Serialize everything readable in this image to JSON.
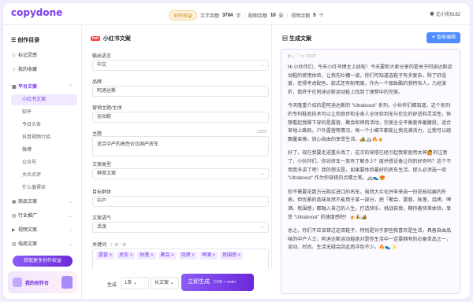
{
  "app": {
    "logo": "copydone"
  },
  "topbar": {
    "member_label": "创作权益",
    "words_label": "文字余额",
    "words_value": "3704",
    "words_unit": "字",
    "images_label": "配图余额",
    "images_value": "10",
    "images_unit": "张",
    "videos_label": "视频余额",
    "videos_value": "5",
    "videos_unit": "个",
    "user": "尤小优6182"
  },
  "sidebar": {
    "title": "创作目录",
    "items": [
      {
        "label": "标记灵感",
        "icon": "bookmark-icon"
      },
      {
        "label": "我的收藏",
        "icon": "star-icon"
      },
      {
        "label": "平台文案",
        "icon": "grid-icon"
      },
      {
        "label": "小红书文案",
        "icon": "xiaohongshu-icon"
      },
      {
        "label": "知乎",
        "icon": "zhihu-icon"
      },
      {
        "label": "今日头条",
        "icon": "toutiao-icon"
      },
      {
        "label": "抖音视频介绍",
        "icon": "douyin-icon"
      },
      {
        "label": "微博",
        "icon": "weibo-icon"
      },
      {
        "label": "公众号",
        "icon": "wechat-icon"
      },
      {
        "label": "大众点评",
        "icon": "dianping-icon"
      },
      {
        "label": "什么值得买",
        "icon": "smzdm-icon"
      },
      {
        "label": "商品文案",
        "icon": "shop-icon"
      },
      {
        "label": "行业推广",
        "icon": "promo-icon"
      },
      {
        "label": "视频文案",
        "icon": "video-icon"
      },
      {
        "label": "电商文案",
        "icon": "cart-icon"
      }
    ],
    "upgrade_label": "获取更多创作权益",
    "card_label": "我的创作台"
  },
  "form": {
    "title": "小红书文案",
    "badge": "hot",
    "fields": {
      "language": {
        "label": "输出语言",
        "value": "中文"
      },
      "brand": {
        "label": "品牌",
        "value": "阿迪达斯"
      },
      "product": {
        "label": "营销主题/主体",
        "value": "运动鞋"
      },
      "topic": {
        "label": "主题",
        "value": "适合中产的高性价比国产房车",
        "counter": "13/50"
      },
      "copy_type": {
        "label": "文案类型",
        "value": "种草文案"
      },
      "audience": {
        "label": "目标群体",
        "value": "中产"
      },
      "tone": {
        "label": "文案语气",
        "value": "活泼"
      }
    },
    "keywords_label": "关键词",
    "keywords_hint": "① 换一换",
    "keywords": [
      "露营",
      "房车",
      "秋蓬",
      "聚会",
      "烧烤",
      "啤酒",
      "氛围感"
    ]
  },
  "generate": {
    "label": "生成",
    "count": "1条",
    "length": "长文案",
    "button": "立即生成",
    "shortcut": "CMD + enter"
  },
  "result": {
    "title": "生成文案",
    "edit_button": "智能编辑",
    "word_count": "722字",
    "paragraphs": [
      "Hi 小伙伴们，今天小红书博主上线啦！今天要和大家分享的是关于阿迪达斯运动鞋的使用体验，让我先吐槽一波，你们可知道选鞋子有多复杂，除了舒适度，还得考虑配色、款式还有耐用度。作为一个极致酷的我特攻人，几经波折，我终于在阿迪达斯运动鞋上找到了理想中的完美。",
      "今天隆重介绍的是阿迪达斯的 \"Ultraboost\" 系列，小伙伴们都知道，这个系列的专利鞋底技术可以让你跑步和全身人全体验到无与伦比的舒适和灵活性，休憩看起我脚下穿的是露营、聚会和烤肉活动，完美全全平衡营养暖腰挺，适合草地上跳跃，户外露营等情况，每一个小细节都能让我充满活力，让我可以跑飘量束捧，放心自由的享受生活。🏕️🚐🔥🍺",
      "好了，现在我要走进重头戏了，这次的穿搭已经引起我家居然女神🙋的注意了，小伙伴们，你对房车一族有了解多少？度并搭设备让你的好奇吗？这个不用我多讲了吧！我的想法是，如果要体验最好的房车生活，那么必须选一双 \"Ultraboost\" 作为你穿搭的点睛之笔。🚐👟😍",
      "你不需要花数万元购买进口的名车，虽然大众化并非来自一份花枝招展的外表，但优雅的品味显然不能用于某一部分，把「聚会、露营、秋蓬、烧烤、啤酒、氛围感」都融入自己的人生，打造快乐、挑战自我，期待着快来体验，享受 \"Ultraboost\" 的速度感吧！🍺🎉🏕️",
      "总之，你们不应该错过这双鞋子，特别是对于那些我喜欢是生活，具备自由品味的中产人士，阿迪达斯运动鞋绝对是你生活中一定要拥有的必备单品之一，运动、时尚、生活无疑会因此而洋色不少。🔥👟✨"
    ]
  }
}
